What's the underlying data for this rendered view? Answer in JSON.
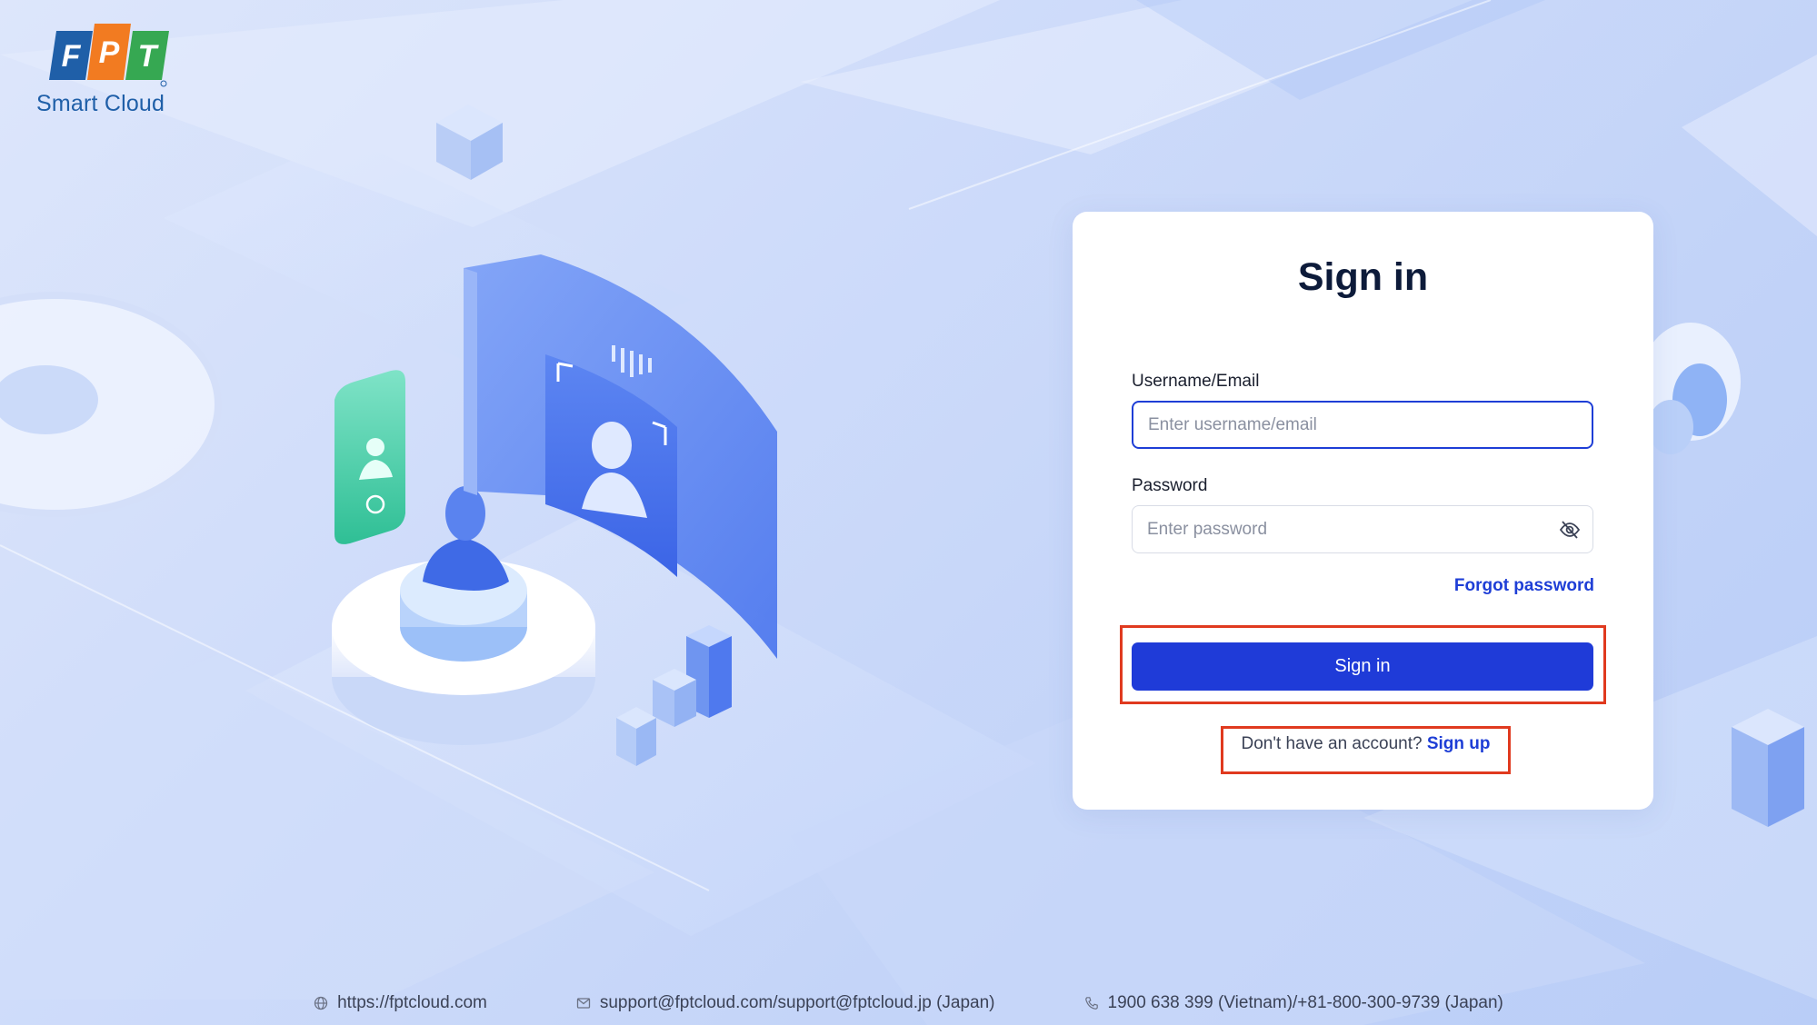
{
  "brand": {
    "logo_letters": [
      "F",
      "P",
      "T"
    ],
    "logo_text": "Smart Cloud",
    "colors": {
      "blue": "#1f5fa8",
      "orange": "#f27b21",
      "green": "#36a852"
    }
  },
  "signin_card": {
    "title": "Sign in",
    "username_label": "Username/Email",
    "username_placeholder": "Enter username/email",
    "username_value": "",
    "password_label": "Password",
    "password_placeholder": "Enter password",
    "password_value": "",
    "password_toggle_icon": "eye-off-icon",
    "forgot_password": "Forgot password",
    "signin_button": "Sign in",
    "no_account_text": "Don't have an account?",
    "signup_link": "Sign up"
  },
  "footer": {
    "website": "https://fptcloud.com",
    "email": "support@fptcloud.com/support@fptcloud.jp (Japan)",
    "phone": "1900 638 399 (Vietnam)/+81-800-300-9739 (Japan)",
    "icons": [
      "globe-icon",
      "mail-icon",
      "phone-icon"
    ]
  },
  "colors": {
    "primary": "#1f3bd8",
    "highlight": "#e03a1f",
    "title": "#0d1b3a"
  }
}
